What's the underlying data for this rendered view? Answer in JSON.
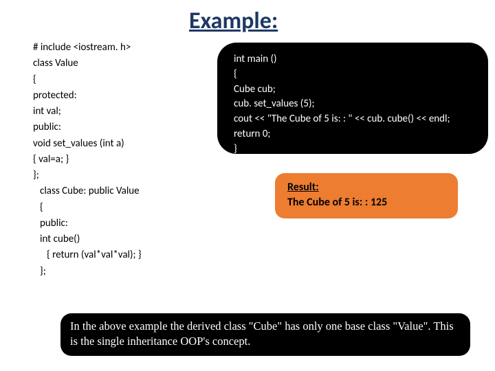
{
  "title": "Example:",
  "code_left": {
    "l1": "# include <iostream. h>",
    "l2": " class Value",
    "l3": "{",
    "l4": " protected:",
    "l5": " int val;",
    "l6": " public:",
    "l7": " void set_values (int a)",
    "l8": "{ val=a; }",
    "l9": "};",
    "l10": "class Cube: public Value",
    "l11": "{",
    "l12": " public:",
    "l13": " int cube()",
    "l14": "{ return (val*val*val);  }",
    "l15": "};"
  },
  "main_code": {
    "m1": "int main ()",
    "m2": "{",
    "m3": "Cube cub;",
    "m4": "cub. set_values (5);",
    "m5": "cout << \"The Cube of 5 is: : \" << cub. cube() << endl;",
    "m6": " return 0;",
    "m7": "}"
  },
  "result": {
    "label": "Result:",
    "text": "The Cube of 5 is: : 125"
  },
  "explain": "In the above example the derived class \"Cube\" has only one base class \"Value\". This is the single inheritance OOP's concept."
}
